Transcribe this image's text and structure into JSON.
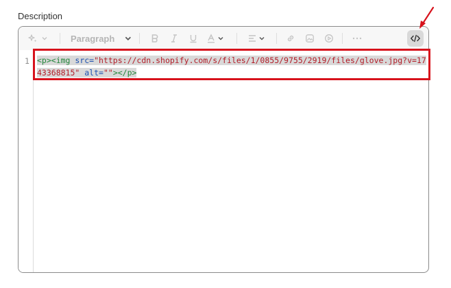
{
  "field": {
    "label": "Description"
  },
  "toolbar": {
    "magic_icon": "sparkles-icon",
    "paragraph_label": "Paragraph",
    "code_toggle_icon": "code-icon"
  },
  "code": {
    "line_number": "1",
    "tokens": {
      "open_p": "<p>",
      "img_open": "<img ",
      "src_attr": "src=",
      "src_value": "\"https://cdn.shopify.com/s/files/1/0855/9755/2919/files/glove.jpg?v=1743368815\"",
      "space": " ",
      "alt_attr": "alt=",
      "alt_value": "\"\"",
      "img_close": ">",
      "close_p": "</p>"
    }
  },
  "annotation": {
    "highlight_color": "#d7121c"
  }
}
